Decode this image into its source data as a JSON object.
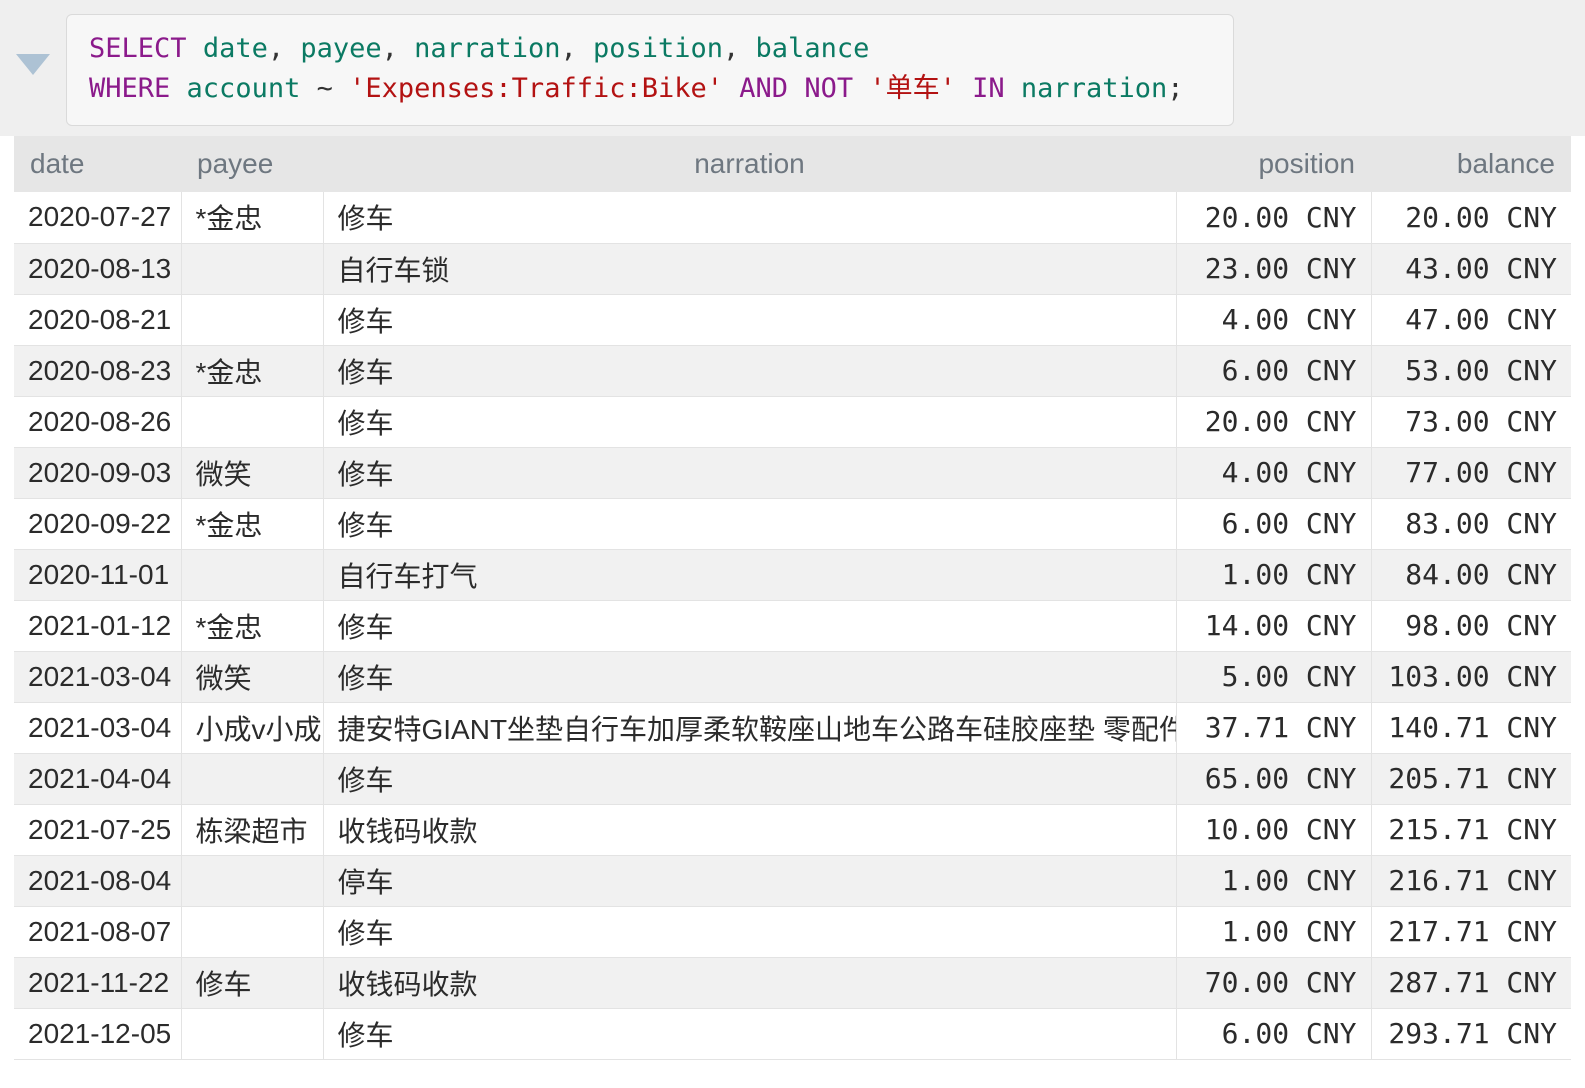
{
  "query": {
    "collapse_icon": "triangle-down-icon",
    "line1": [
      {
        "t": "SELECT",
        "c": "kw"
      },
      {
        "t": " ",
        "c": "op"
      },
      {
        "t": "date",
        "c": "id"
      },
      {
        "t": ", ",
        "c": "punc"
      },
      {
        "t": "payee",
        "c": "id"
      },
      {
        "t": ", ",
        "c": "punc"
      },
      {
        "t": "narration",
        "c": "id"
      },
      {
        "t": ", ",
        "c": "punc"
      },
      {
        "t": "position",
        "c": "id"
      },
      {
        "t": ", ",
        "c": "punc"
      },
      {
        "t": "balance",
        "c": "id"
      }
    ],
    "line2": [
      {
        "t": "WHERE",
        "c": "kw"
      },
      {
        "t": " ",
        "c": "op"
      },
      {
        "t": "account",
        "c": "id"
      },
      {
        "t": " ~ ",
        "c": "op"
      },
      {
        "t": "'Expenses:Traffic:Bike'",
        "c": "str"
      },
      {
        "t": " ",
        "c": "op"
      },
      {
        "t": "AND",
        "c": "kw"
      },
      {
        "t": " ",
        "c": "op"
      },
      {
        "t": "NOT",
        "c": "kw"
      },
      {
        "t": " ",
        "c": "op"
      },
      {
        "t": "'单车'",
        "c": "str"
      },
      {
        "t": " ",
        "c": "op"
      },
      {
        "t": "IN",
        "c": "kw"
      },
      {
        "t": " ",
        "c": "op"
      },
      {
        "t": "narration",
        "c": "id"
      },
      {
        "t": ";",
        "c": "punc"
      }
    ],
    "plain_text": "SELECT date, payee, narration, position, balance\nWHERE account ~ 'Expenses:Traffic:Bike' AND NOT '单车' IN narration;"
  },
  "table": {
    "columns": [
      {
        "key": "date",
        "label": "date"
      },
      {
        "key": "payee",
        "label": "payee"
      },
      {
        "key": "narration",
        "label": "narration"
      },
      {
        "key": "position",
        "label": "position"
      },
      {
        "key": "balance",
        "label": "balance"
      }
    ],
    "rows": [
      {
        "date": "2020-07-27",
        "payee": "*金忠",
        "narration": "修车",
        "position": "20.00 CNY",
        "balance": "20.00 CNY"
      },
      {
        "date": "2020-08-13",
        "payee": "",
        "narration": "自行车锁",
        "position": "23.00 CNY",
        "balance": "43.00 CNY"
      },
      {
        "date": "2020-08-21",
        "payee": "",
        "narration": "修车",
        "position": "4.00 CNY",
        "balance": "47.00 CNY"
      },
      {
        "date": "2020-08-23",
        "payee": "*金忠",
        "narration": "修车",
        "position": "6.00 CNY",
        "balance": "53.00 CNY"
      },
      {
        "date": "2020-08-26",
        "payee": "",
        "narration": "修车",
        "position": "20.00 CNY",
        "balance": "73.00 CNY"
      },
      {
        "date": "2020-09-03",
        "payee": "微笑",
        "narration": "修车",
        "position": "4.00 CNY",
        "balance": "77.00 CNY"
      },
      {
        "date": "2020-09-22",
        "payee": "*金忠",
        "narration": "修车",
        "position": "6.00 CNY",
        "balance": "83.00 CNY"
      },
      {
        "date": "2020-11-01",
        "payee": "",
        "narration": "自行车打气",
        "position": "1.00 CNY",
        "balance": "84.00 CNY"
      },
      {
        "date": "2021-01-12",
        "payee": "*金忠",
        "narration": "修车",
        "position": "14.00 CNY",
        "balance": "98.00 CNY"
      },
      {
        "date": "2021-03-04",
        "payee": "微笑",
        "narration": "修车",
        "position": "5.00 CNY",
        "balance": "103.00 CNY"
      },
      {
        "date": "2021-03-04",
        "payee": "小成v小成",
        "narration": "捷安特GIANT坐垫自行车加厚柔软鞍座山地车公路车硅胶座垫 零配件",
        "position": "37.71 CNY",
        "balance": "140.71 CNY"
      },
      {
        "date": "2021-04-04",
        "payee": "",
        "narration": "修车",
        "position": "65.00 CNY",
        "balance": "205.71 CNY"
      },
      {
        "date": "2021-07-25",
        "payee": "栋梁超市",
        "narration": "收钱码收款",
        "position": "10.00 CNY",
        "balance": "215.71 CNY"
      },
      {
        "date": "2021-08-04",
        "payee": "",
        "narration": "停车",
        "position": "1.00 CNY",
        "balance": "216.71 CNY"
      },
      {
        "date": "2021-08-07",
        "payee": "",
        "narration": "修车",
        "position": "1.00 CNY",
        "balance": "217.71 CNY"
      },
      {
        "date": "2021-11-22",
        "payee": "修车",
        "narration": "收钱码收款",
        "position": "70.00 CNY",
        "balance": "287.71 CNY"
      },
      {
        "date": "2021-12-05",
        "payee": "",
        "narration": "修车",
        "position": "6.00 CNY",
        "balance": "293.71 CNY"
      }
    ]
  },
  "colors": {
    "keyword": "#8b1a8b",
    "identifier": "#0b7a63",
    "string": "#b31212",
    "header_bg": "#e6e6e6",
    "header_text": "#6e7780",
    "row_alt_bg": "#f1f1f1",
    "query_bg": "#efefef",
    "query_box_bg": "#f7f7f7",
    "toggle_icon": "#adc2d4"
  }
}
